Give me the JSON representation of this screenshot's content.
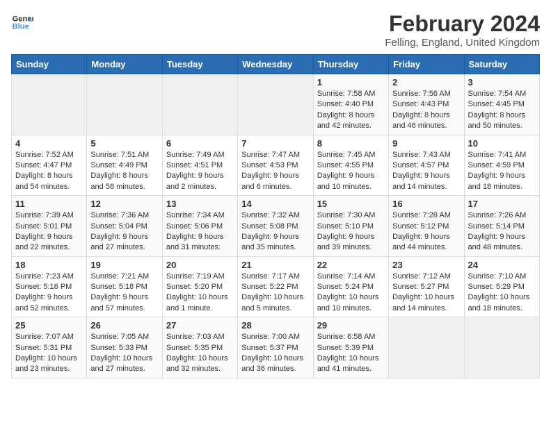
{
  "logo": {
    "line1": "General",
    "line2": "Blue"
  },
  "title": "February 2024",
  "subtitle": "Felling, England, United Kingdom",
  "days_of_week": [
    "Sunday",
    "Monday",
    "Tuesday",
    "Wednesday",
    "Thursday",
    "Friday",
    "Saturday"
  ],
  "weeks": [
    [
      {
        "day": "",
        "content": ""
      },
      {
        "day": "",
        "content": ""
      },
      {
        "day": "",
        "content": ""
      },
      {
        "day": "",
        "content": ""
      },
      {
        "day": "1",
        "content": "Sunrise: 7:58 AM\nSunset: 4:40 PM\nDaylight: 8 hours and 42 minutes."
      },
      {
        "day": "2",
        "content": "Sunrise: 7:56 AM\nSunset: 4:43 PM\nDaylight: 8 hours and 46 minutes."
      },
      {
        "day": "3",
        "content": "Sunrise: 7:54 AM\nSunset: 4:45 PM\nDaylight: 8 hours and 50 minutes."
      }
    ],
    [
      {
        "day": "4",
        "content": "Sunrise: 7:52 AM\nSunset: 4:47 PM\nDaylight: 8 hours and 54 minutes."
      },
      {
        "day": "5",
        "content": "Sunrise: 7:51 AM\nSunset: 4:49 PM\nDaylight: 8 hours and 58 minutes."
      },
      {
        "day": "6",
        "content": "Sunrise: 7:49 AM\nSunset: 4:51 PM\nDaylight: 9 hours and 2 minutes."
      },
      {
        "day": "7",
        "content": "Sunrise: 7:47 AM\nSunset: 4:53 PM\nDaylight: 9 hours and 6 minutes."
      },
      {
        "day": "8",
        "content": "Sunrise: 7:45 AM\nSunset: 4:55 PM\nDaylight: 9 hours and 10 minutes."
      },
      {
        "day": "9",
        "content": "Sunrise: 7:43 AM\nSunset: 4:57 PM\nDaylight: 9 hours and 14 minutes."
      },
      {
        "day": "10",
        "content": "Sunrise: 7:41 AM\nSunset: 4:59 PM\nDaylight: 9 hours and 18 minutes."
      }
    ],
    [
      {
        "day": "11",
        "content": "Sunrise: 7:39 AM\nSunset: 5:01 PM\nDaylight: 9 hours and 22 minutes."
      },
      {
        "day": "12",
        "content": "Sunrise: 7:36 AM\nSunset: 5:04 PM\nDaylight: 9 hours and 27 minutes."
      },
      {
        "day": "13",
        "content": "Sunrise: 7:34 AM\nSunset: 5:06 PM\nDaylight: 9 hours and 31 minutes."
      },
      {
        "day": "14",
        "content": "Sunrise: 7:32 AM\nSunset: 5:08 PM\nDaylight: 9 hours and 35 minutes."
      },
      {
        "day": "15",
        "content": "Sunrise: 7:30 AM\nSunset: 5:10 PM\nDaylight: 9 hours and 39 minutes."
      },
      {
        "day": "16",
        "content": "Sunrise: 7:28 AM\nSunset: 5:12 PM\nDaylight: 9 hours and 44 minutes."
      },
      {
        "day": "17",
        "content": "Sunrise: 7:26 AM\nSunset: 5:14 PM\nDaylight: 9 hours and 48 minutes."
      }
    ],
    [
      {
        "day": "18",
        "content": "Sunrise: 7:23 AM\nSunset: 5:16 PM\nDaylight: 9 hours and 52 minutes."
      },
      {
        "day": "19",
        "content": "Sunrise: 7:21 AM\nSunset: 5:18 PM\nDaylight: 9 hours and 57 minutes."
      },
      {
        "day": "20",
        "content": "Sunrise: 7:19 AM\nSunset: 5:20 PM\nDaylight: 10 hours and 1 minute."
      },
      {
        "day": "21",
        "content": "Sunrise: 7:17 AM\nSunset: 5:22 PM\nDaylight: 10 hours and 5 minutes."
      },
      {
        "day": "22",
        "content": "Sunrise: 7:14 AM\nSunset: 5:24 PM\nDaylight: 10 hours and 10 minutes."
      },
      {
        "day": "23",
        "content": "Sunrise: 7:12 AM\nSunset: 5:27 PM\nDaylight: 10 hours and 14 minutes."
      },
      {
        "day": "24",
        "content": "Sunrise: 7:10 AM\nSunset: 5:29 PM\nDaylight: 10 hours and 18 minutes."
      }
    ],
    [
      {
        "day": "25",
        "content": "Sunrise: 7:07 AM\nSunset: 5:31 PM\nDaylight: 10 hours and 23 minutes."
      },
      {
        "day": "26",
        "content": "Sunrise: 7:05 AM\nSunset: 5:33 PM\nDaylight: 10 hours and 27 minutes."
      },
      {
        "day": "27",
        "content": "Sunrise: 7:03 AM\nSunset: 5:35 PM\nDaylight: 10 hours and 32 minutes."
      },
      {
        "day": "28",
        "content": "Sunrise: 7:00 AM\nSunset: 5:37 PM\nDaylight: 10 hours and 36 minutes."
      },
      {
        "day": "29",
        "content": "Sunrise: 6:58 AM\nSunset: 5:39 PM\nDaylight: 10 hours and 41 minutes."
      },
      {
        "day": "",
        "content": ""
      },
      {
        "day": "",
        "content": ""
      }
    ]
  ]
}
